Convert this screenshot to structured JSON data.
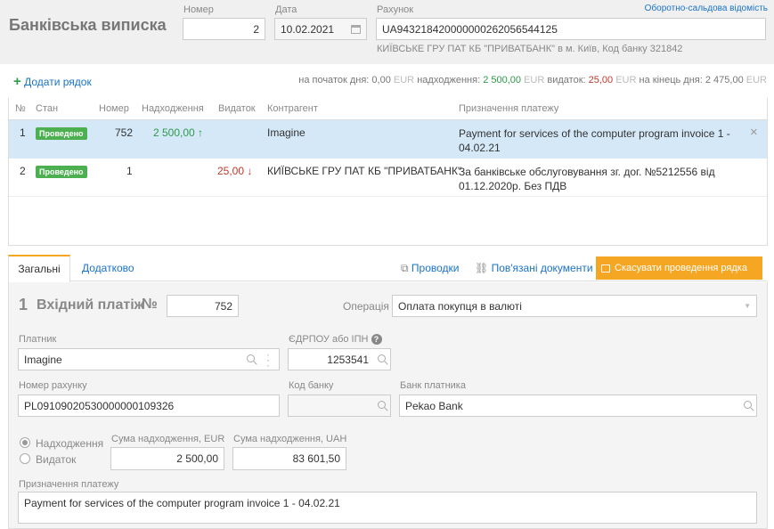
{
  "header": {
    "title": "Банківська виписка",
    "number_label": "Номер",
    "number_value": "2",
    "date_label": "Дата",
    "date_value": "10.02.2021",
    "account_label": "Рахунок",
    "account_value": "UA943218420000000262056544125",
    "account_bank": "КИЇВСЬКЕ ГРУ ПАТ КБ \"ПРИВАТБАНК\" в м. Київ, Код банку 321842",
    "turnover_link": "Оборотно-сальдова відомість"
  },
  "toolbar": {
    "add_row": "Додати рядок",
    "summary": {
      "start_label": "на початок дня:",
      "start_value": "0,00",
      "currency": "EUR",
      "income_label": "надходження:",
      "income_value": "2 500,00",
      "expense_label": "видаток:",
      "expense_value": "25,00",
      "end_label": "на кінець дня:",
      "end_value": "2 475,00"
    }
  },
  "table": {
    "columns": [
      "№",
      "Стан",
      "Номер",
      "Надходження",
      "Видаток",
      "Контрагент",
      "Призначення платежу"
    ],
    "rows": [
      {
        "n": "1",
        "status": "Проведено",
        "number": "752",
        "income": "2 500,00 ↑",
        "expense": "",
        "counterparty": "Imagine",
        "purpose": "Payment for services of the computer program invoice 1 - 04.02.21"
      },
      {
        "n": "2",
        "status": "Проведено",
        "number": "1",
        "income": "",
        "expense": "25,00 ↓",
        "counterparty": "КИЇВСЬКЕ ГРУ ПАТ КБ \"ПРИВАТБАНК\"",
        "purpose": "За банківське обслуговування зг. дог. №5212556 від 01.12.2020р. Без ПДВ"
      }
    ]
  },
  "tabs": {
    "general": "Загальні",
    "additional": "Додатково",
    "postings": "Проводки",
    "related_docs": "Пов'язані документи",
    "cancel_posting": "Скасувати проведення рядка"
  },
  "detail": {
    "row_num": "1",
    "type_title": "Вхідний платіж",
    "num_sign": "№",
    "num_value": "752",
    "operation_label": "Операція",
    "operation_value": "Оплата покупця в валюті",
    "payer_label": "Платник",
    "payer_value": "Imagine",
    "edrpou_label": "ЄДРПОУ або ІПН",
    "edrpou_value": "1253541",
    "account_no_label": "Номер рахунку",
    "account_no_value": "PL09109020530000000109326",
    "bank_code_label": "Код банку",
    "bank_code_value": "",
    "payer_bank_label": "Банк платника",
    "payer_bank_value": "Pekao Bank",
    "radio_income": "Надходження",
    "radio_expense": "Видаток",
    "sum_eur_label": "Сума надходження, EUR",
    "sum_eur_value": "2 500,00",
    "sum_uah_label": "Сума надходження, UAH",
    "sum_uah_value": "83 601,50",
    "purpose_label": "Призначення платежу",
    "purpose_value": "Payment for services of the computer program invoice 1 - 04.02.21"
  },
  "colors": {
    "accent": "#1a73c7",
    "posted_badge": "#4caf50",
    "income": "#2e9a4a",
    "expense": "#c0392b",
    "selected_row": "#d4e8f7",
    "cancel_button": "#f5a623"
  }
}
